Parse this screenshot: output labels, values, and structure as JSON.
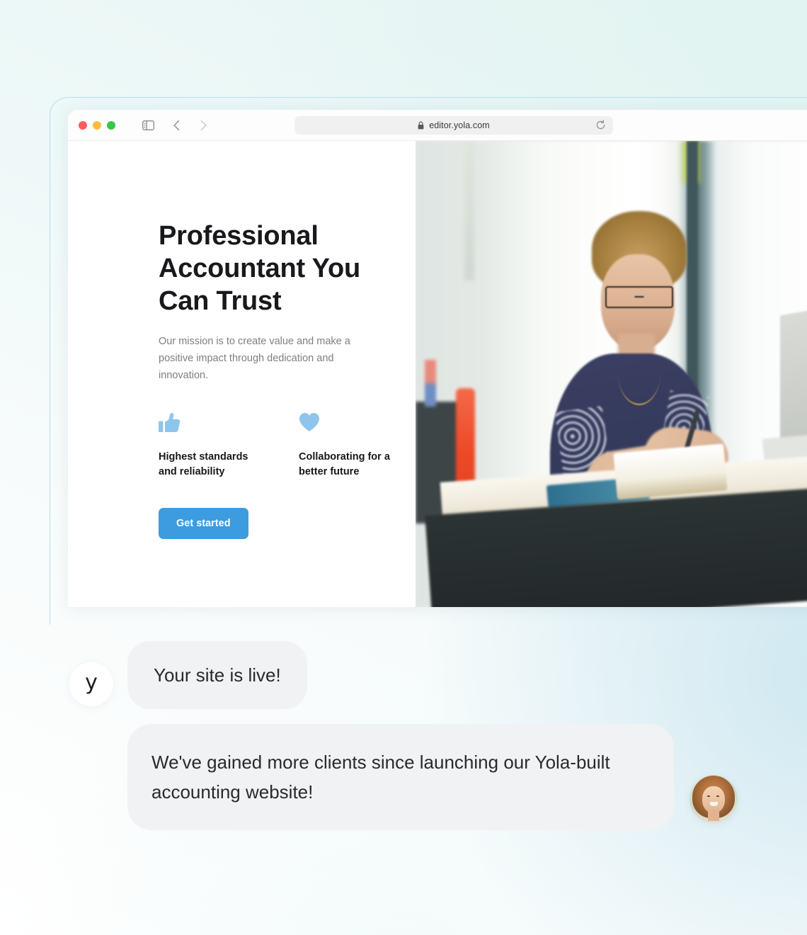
{
  "browser": {
    "traffic_lights": [
      {
        "name": "close",
        "color": "#fc5c5c"
      },
      {
        "name": "minimize",
        "color": "#fdbc40"
      },
      {
        "name": "maximize",
        "color": "#34c749"
      }
    ],
    "sidebar_toggle": "sidebar-toggle-icon",
    "back_label": "back-icon",
    "forward_label": "forward-icon",
    "shield_label": "shield-icon",
    "lock_label": "lock-icon",
    "url": "editor.yola.com",
    "reload_label": "reload-icon"
  },
  "site": {
    "hero": {
      "title": "Professional Accountant You Can Trust",
      "subtitle": "Our mission is to create value and make a positive impact through dedication and innovation.",
      "cta_label": "Get started",
      "cta_color": "#3d9be0",
      "icon_color": "#8fc5ec"
    },
    "features": [
      {
        "icon": "thumbs-up-icon",
        "label": "Highest standards and reliability"
      },
      {
        "icon": "heart-icon",
        "label": "Collaborating for a better future"
      }
    ],
    "photo_alt": "Accountant writing notes at a standing desk with a laptop"
  },
  "chat": {
    "brand_initial": "y",
    "messages": [
      {
        "from": "yola",
        "text": "Your site is live!"
      },
      {
        "from": "customer",
        "text": "We've gained more clients since launching our Yola-built accounting website!"
      }
    ],
    "customer_avatar_alt": "Smiling woman with auburn hair"
  },
  "theme": {
    "background_mint": "#e3f4f2",
    "background_blue": "#d2e9f0",
    "frame_border": "#b9dcec",
    "bubble_bg": "#f1f2f3",
    "text_dark": "#17191c",
    "text_muted": "#7b7f84"
  }
}
